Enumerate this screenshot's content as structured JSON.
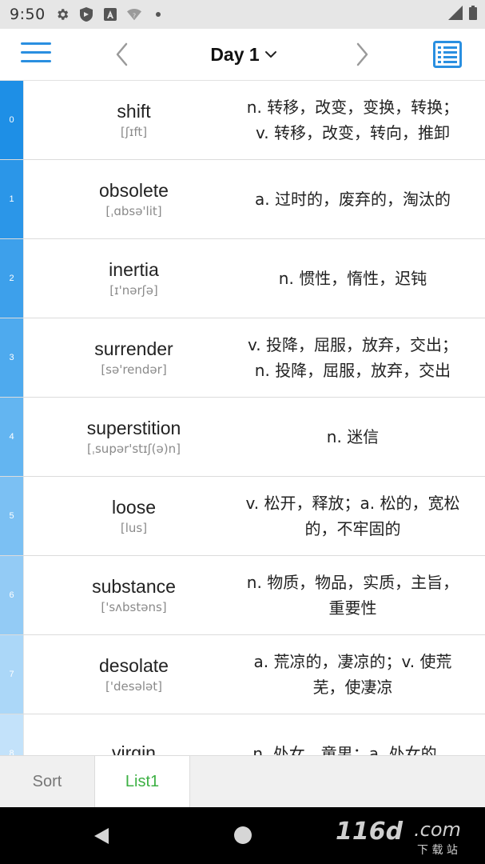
{
  "status_bar": {
    "time": "9:50"
  },
  "toolbar": {
    "day_label": "Day 1",
    "menu_icon": "hamburger-menu-icon",
    "prev_icon": "chevron-left-icon",
    "next_icon": "chevron-right-icon",
    "list_icon": "list-view-icon",
    "accent_color": "#2a8fe0"
  },
  "words": [
    {
      "index": "0",
      "word": "shift",
      "phonetic": "[ʃɪft]",
      "meaning": "n. 转移，改变，变换，转换；v. 转移，改变，转向，推卸",
      "color": "#1e8fe6"
    },
    {
      "index": "1",
      "word": "obsolete",
      "phonetic": "[ˌɑbsə'lit]",
      "meaning": "a. 过时的，废弃的，淘汰的",
      "color": "#2b96e8"
    },
    {
      "index": "2",
      "word": "inertia",
      "phonetic": "[ɪ'nərʃə]",
      "meaning": "n. 惯性，惰性，迟钝",
      "color": "#3da0eb"
    },
    {
      "index": "3",
      "word": "surrender",
      "phonetic": "[sə'rendər]",
      "meaning": "v. 投降，屈服，放弃，交出；n. 投降，屈服，放弃，交出",
      "color": "#4eaaee"
    },
    {
      "index": "4",
      "word": "superstition",
      "phonetic": "[ˌsupər'stɪʃ(ə)n]",
      "meaning": "n. 迷信",
      "color": "#63b5f1"
    },
    {
      "index": "5",
      "word": "loose",
      "phonetic": "[lus]",
      "meaning": "v. 松开，释放；a. 松的，宽松的，不牢固的",
      "color": "#7bc0f3"
    },
    {
      "index": "6",
      "word": "substance",
      "phonetic": "['sʌbstəns]",
      "meaning": "n. 物质，物品，实质，主旨，重要性",
      "color": "#93cbf5"
    },
    {
      "index": "7",
      "word": "desolate",
      "phonetic": "['desələt]",
      "meaning": "a. 荒凉的，凄凉的；v. 使荒芜，使凄凉",
      "color": "#abd7f8"
    },
    {
      "index": "8",
      "word": "virgin",
      "phonetic": "",
      "meaning": "n. 处女，童男；a. 处女的，",
      "color": "#c3e2fa"
    }
  ],
  "tabs": [
    {
      "label": "Sort"
    },
    {
      "label": "List1",
      "color": "#3cb043"
    }
  ],
  "watermark": {
    "brand": "116d",
    "suffix": ".com",
    "subtitle": "下 载 站"
  }
}
